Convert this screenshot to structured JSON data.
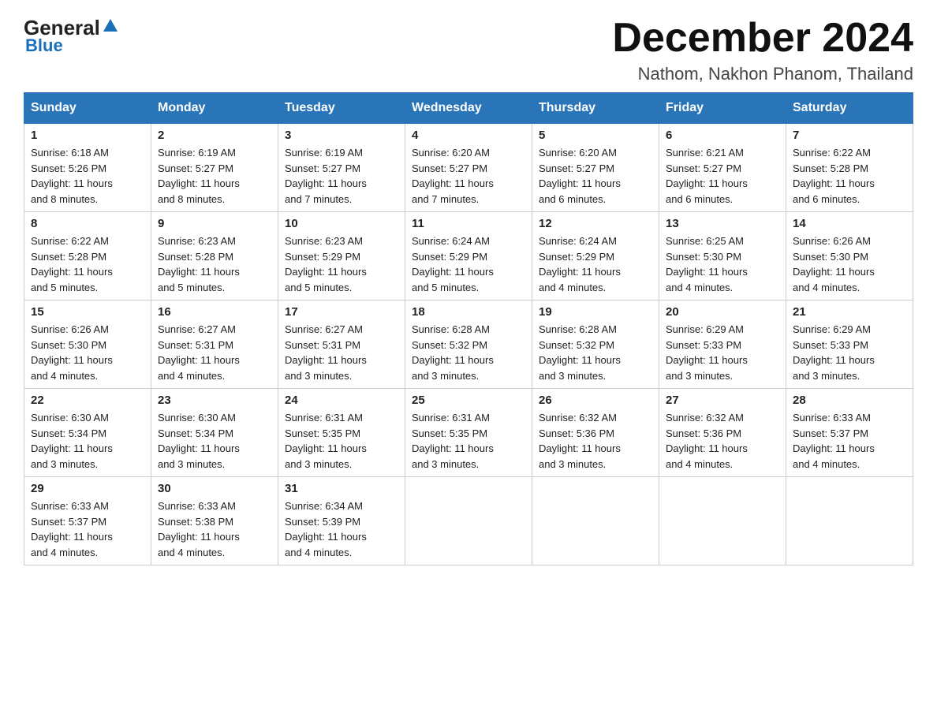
{
  "header": {
    "logo": {
      "general": "General",
      "blue": "Blue"
    },
    "title": "December 2024",
    "location": "Nathom, Nakhon Phanom, Thailand"
  },
  "weekdays": [
    "Sunday",
    "Monday",
    "Tuesday",
    "Wednesday",
    "Thursday",
    "Friday",
    "Saturday"
  ],
  "weeks": [
    [
      {
        "day": "1",
        "sunrise": "6:18 AM",
        "sunset": "5:26 PM",
        "daylight": "11 hours and 8 minutes."
      },
      {
        "day": "2",
        "sunrise": "6:19 AM",
        "sunset": "5:27 PM",
        "daylight": "11 hours and 8 minutes."
      },
      {
        "day": "3",
        "sunrise": "6:19 AM",
        "sunset": "5:27 PM",
        "daylight": "11 hours and 7 minutes."
      },
      {
        "day": "4",
        "sunrise": "6:20 AM",
        "sunset": "5:27 PM",
        "daylight": "11 hours and 7 minutes."
      },
      {
        "day": "5",
        "sunrise": "6:20 AM",
        "sunset": "5:27 PM",
        "daylight": "11 hours and 6 minutes."
      },
      {
        "day": "6",
        "sunrise": "6:21 AM",
        "sunset": "5:27 PM",
        "daylight": "11 hours and 6 minutes."
      },
      {
        "day": "7",
        "sunrise": "6:22 AM",
        "sunset": "5:28 PM",
        "daylight": "11 hours and 6 minutes."
      }
    ],
    [
      {
        "day": "8",
        "sunrise": "6:22 AM",
        "sunset": "5:28 PM",
        "daylight": "11 hours and 5 minutes."
      },
      {
        "day": "9",
        "sunrise": "6:23 AM",
        "sunset": "5:28 PM",
        "daylight": "11 hours and 5 minutes."
      },
      {
        "day": "10",
        "sunrise": "6:23 AM",
        "sunset": "5:29 PM",
        "daylight": "11 hours and 5 minutes."
      },
      {
        "day": "11",
        "sunrise": "6:24 AM",
        "sunset": "5:29 PM",
        "daylight": "11 hours and 5 minutes."
      },
      {
        "day": "12",
        "sunrise": "6:24 AM",
        "sunset": "5:29 PM",
        "daylight": "11 hours and 4 minutes."
      },
      {
        "day": "13",
        "sunrise": "6:25 AM",
        "sunset": "5:30 PM",
        "daylight": "11 hours and 4 minutes."
      },
      {
        "day": "14",
        "sunrise": "6:26 AM",
        "sunset": "5:30 PM",
        "daylight": "11 hours and 4 minutes."
      }
    ],
    [
      {
        "day": "15",
        "sunrise": "6:26 AM",
        "sunset": "5:30 PM",
        "daylight": "11 hours and 4 minutes."
      },
      {
        "day": "16",
        "sunrise": "6:27 AM",
        "sunset": "5:31 PM",
        "daylight": "11 hours and 4 minutes."
      },
      {
        "day": "17",
        "sunrise": "6:27 AM",
        "sunset": "5:31 PM",
        "daylight": "11 hours and 3 minutes."
      },
      {
        "day": "18",
        "sunrise": "6:28 AM",
        "sunset": "5:32 PM",
        "daylight": "11 hours and 3 minutes."
      },
      {
        "day": "19",
        "sunrise": "6:28 AM",
        "sunset": "5:32 PM",
        "daylight": "11 hours and 3 minutes."
      },
      {
        "day": "20",
        "sunrise": "6:29 AM",
        "sunset": "5:33 PM",
        "daylight": "11 hours and 3 minutes."
      },
      {
        "day": "21",
        "sunrise": "6:29 AM",
        "sunset": "5:33 PM",
        "daylight": "11 hours and 3 minutes."
      }
    ],
    [
      {
        "day": "22",
        "sunrise": "6:30 AM",
        "sunset": "5:34 PM",
        "daylight": "11 hours and 3 minutes."
      },
      {
        "day": "23",
        "sunrise": "6:30 AM",
        "sunset": "5:34 PM",
        "daylight": "11 hours and 3 minutes."
      },
      {
        "day": "24",
        "sunrise": "6:31 AM",
        "sunset": "5:35 PM",
        "daylight": "11 hours and 3 minutes."
      },
      {
        "day": "25",
        "sunrise": "6:31 AM",
        "sunset": "5:35 PM",
        "daylight": "11 hours and 3 minutes."
      },
      {
        "day": "26",
        "sunrise": "6:32 AM",
        "sunset": "5:36 PM",
        "daylight": "11 hours and 3 minutes."
      },
      {
        "day": "27",
        "sunrise": "6:32 AM",
        "sunset": "5:36 PM",
        "daylight": "11 hours and 4 minutes."
      },
      {
        "day": "28",
        "sunrise": "6:33 AM",
        "sunset": "5:37 PM",
        "daylight": "11 hours and 4 minutes."
      }
    ],
    [
      {
        "day": "29",
        "sunrise": "6:33 AM",
        "sunset": "5:37 PM",
        "daylight": "11 hours and 4 minutes."
      },
      {
        "day": "30",
        "sunrise": "6:33 AM",
        "sunset": "5:38 PM",
        "daylight": "11 hours and 4 minutes."
      },
      {
        "day": "31",
        "sunrise": "6:34 AM",
        "sunset": "5:39 PM",
        "daylight": "11 hours and 4 minutes."
      },
      null,
      null,
      null,
      null
    ]
  ],
  "labels": {
    "sunrise": "Sunrise:",
    "sunset": "Sunset:",
    "daylight": "Daylight:"
  }
}
